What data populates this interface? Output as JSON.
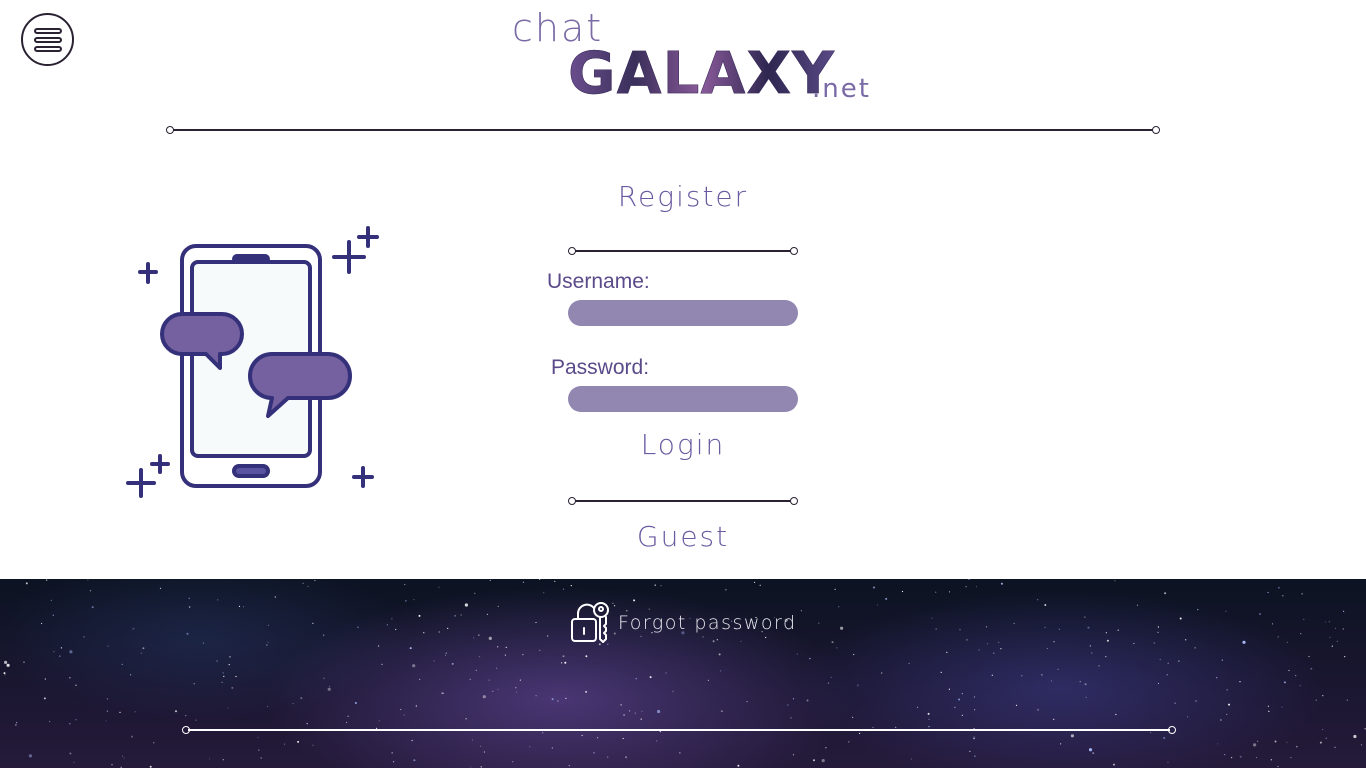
{
  "header": {
    "logo_chat": "chat",
    "logo_galaxy": "GALAXY",
    "logo_net": ".net",
    "menu_icon": "hamburger-menu-icon"
  },
  "form": {
    "register_label": "Register",
    "username_label": "Username:",
    "username_value": "",
    "password_label": "Password:",
    "password_value": "",
    "login_label": "Login",
    "guest_label": "Guest"
  },
  "footer": {
    "forgot_label": "Forgot password",
    "forgot_icon": "unlock-key-icon"
  },
  "colors": {
    "accent_purple": "#6a5aa0",
    "input_fill": "#9287b0",
    "line_dark": "#2a2233",
    "illustration_blue": "#34307a",
    "bubble_purple": "#7560a0"
  }
}
